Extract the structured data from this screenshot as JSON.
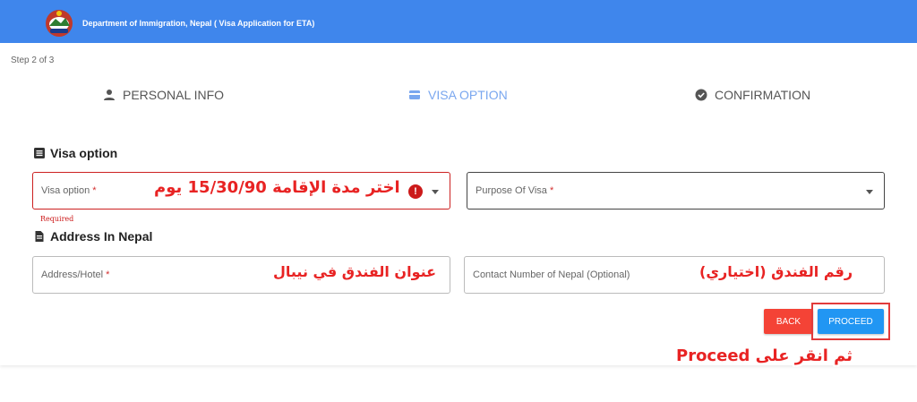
{
  "header": {
    "title": "Department of Immigration, Nepal ( Visa Application for ETA)",
    "bg": "#3f86ec"
  },
  "step_indicator": "Step 2 of 3",
  "stepper": [
    {
      "label": "PERSONAL INFO",
      "icon": "person-icon",
      "active": false
    },
    {
      "label": "VISA OPTION",
      "icon": "card-icon",
      "active": true
    },
    {
      "label": "CONFIRMATION",
      "icon": "check-circle-icon",
      "active": false
    }
  ],
  "visa_section": {
    "title": "Visa option",
    "visa_option_label": "Visa option",
    "purpose_label": "Purpose Of Visa",
    "required_marker": "*",
    "error_text": "Required"
  },
  "address_section": {
    "title": "Address In Nepal",
    "address_label": "Address/Hotel",
    "contact_label": "Contact Number of Nepal (Optional)",
    "required_marker": "*"
  },
  "buttons": {
    "back": "BACK",
    "proceed": "PROCEED"
  },
  "annotations": {
    "visa": "اختر مدة الإقامة 15/30/90 يوم",
    "address": "عنوان الفندق في نيبال",
    "contact": "رقم الفندق (اختياري)",
    "proceed": "ثم انقر على Proceed"
  },
  "colors": {
    "accent": "#2196f3",
    "back": "#f44336",
    "error": "#cc1a1a",
    "annotation": "#e82323"
  }
}
